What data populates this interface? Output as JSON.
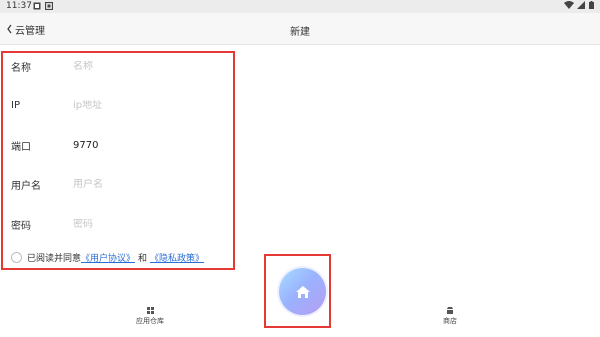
{
  "status_bar": {
    "time": "11:37"
  },
  "nav": {
    "back_label": "云管理",
    "title": "新建"
  },
  "form": {
    "name": {
      "label": "名称",
      "placeholder": "名称",
      "value": ""
    },
    "ip": {
      "label": "IP",
      "placeholder": "ip地址",
      "value": ""
    },
    "port": {
      "label": "端口",
      "placeholder": "",
      "value": "9770"
    },
    "username": {
      "label": "用户名",
      "placeholder": "用户名",
      "value": ""
    },
    "password": {
      "label": "密码",
      "placeholder": "密码",
      "value": ""
    }
  },
  "agreement": {
    "prefix": "已阅读并同意",
    "user_agreement": "《用户协议》",
    "and": "和",
    "privacy_policy": "《隐私政策》"
  },
  "bottom_nav": {
    "left_label": "应用仓库",
    "right_label": "商店"
  },
  "colors": {
    "accent": "#2b6fd6",
    "highlight_border": "#e53935"
  }
}
